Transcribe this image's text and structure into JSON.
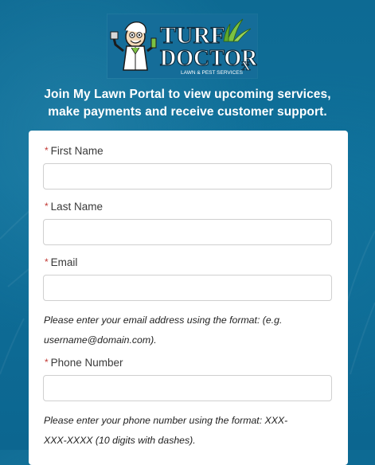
{
  "logo": {
    "line1": "TURF",
    "line2": "DOCTOR",
    "rx_mark": "X",
    "subline": "LAWN & PEST SERVICES",
    "mascot": "doctor-mascot"
  },
  "intro": {
    "line1": "Join My Lawn Portal to view upcoming services,",
    "line2": "make payments and receive customer support."
  },
  "form": {
    "required_marker": "*",
    "first_name": {
      "label": "First Name",
      "value": "",
      "placeholder": ""
    },
    "last_name": {
      "label": "Last Name",
      "value": "",
      "placeholder": ""
    },
    "email": {
      "label": "Email",
      "value": "",
      "placeholder": "",
      "help_line1": "Please enter your email address using the format: (e.g.",
      "help_line2": "username@domain.com)."
    },
    "phone": {
      "label": "Phone Number",
      "value": "",
      "placeholder": "",
      "help_line1": "Please enter your phone number using the format: XXX-",
      "help_line2": "XXX-XXXX (10 digits with dashes)."
    }
  },
  "colors": {
    "background": "#0f709a",
    "logo_bg": "#156d99",
    "required": "#c23934",
    "card": "#ffffff",
    "accent_green": "#7cc242"
  }
}
